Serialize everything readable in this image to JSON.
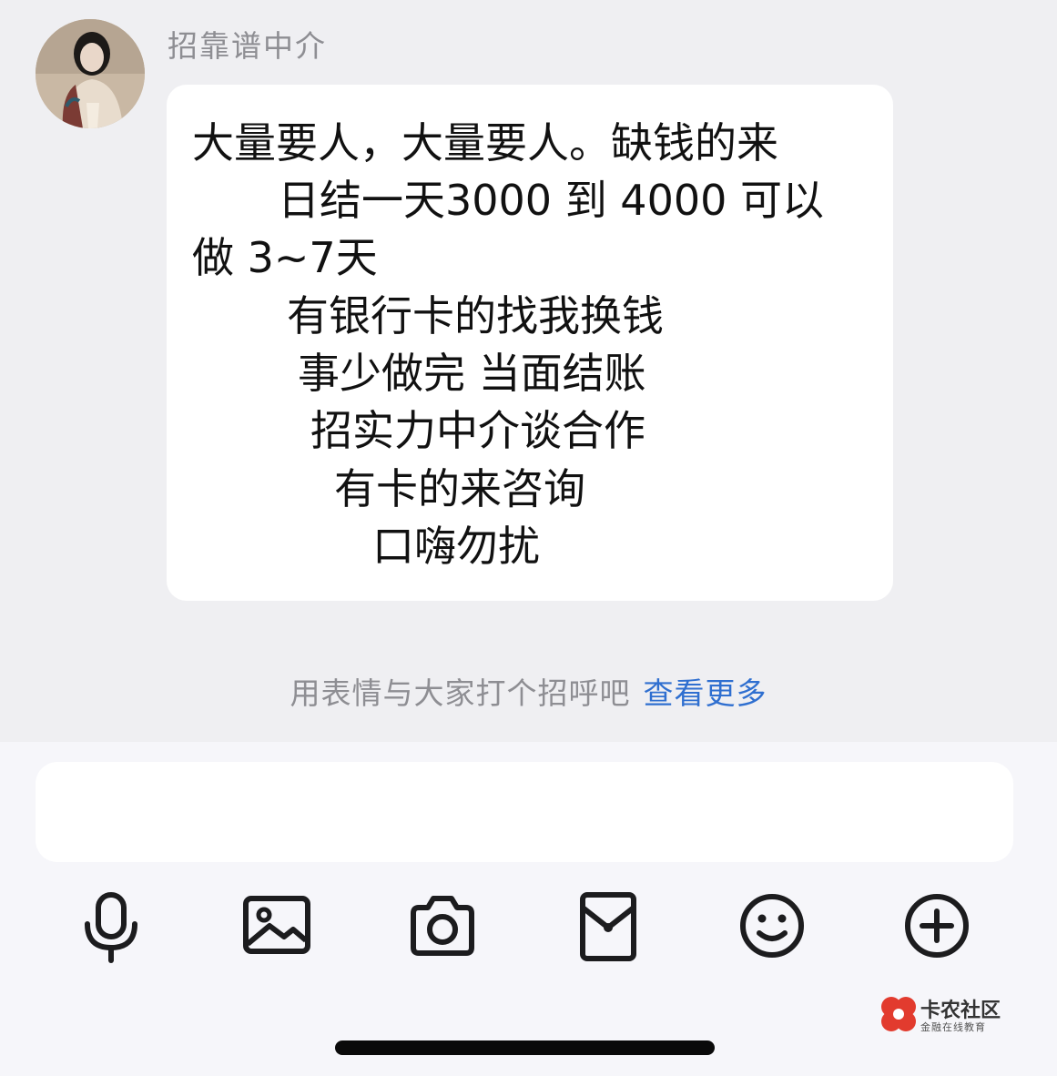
{
  "chat": {
    "sender_name": "招靠谱中介",
    "message_lines": [
      "大量要人，大量要人。缺钱的来",
      "日结一天3000 到 4000 可以",
      "做 3~7天",
      "有银行卡的找我换钱",
      "事少做完 当面结账",
      "招实力中介谈合作",
      "有卡的来咨询",
      "口嗨勿扰"
    ]
  },
  "hint": {
    "text": "用表情与大家打个招呼吧",
    "link": "查看更多"
  },
  "composer": {
    "input_value": "",
    "tools": [
      "microphone-icon",
      "image-icon",
      "camera-icon",
      "red-envelope-icon",
      "emoji-icon",
      "plus-icon"
    ]
  },
  "watermark": {
    "title": "卡农社区",
    "subtitle": "金融在线教育"
  },
  "colors": {
    "link": "#2f6fd0",
    "chat_background": "#efeff2",
    "bubble": "#ffffff",
    "watermark_red": "#e23b2e"
  }
}
